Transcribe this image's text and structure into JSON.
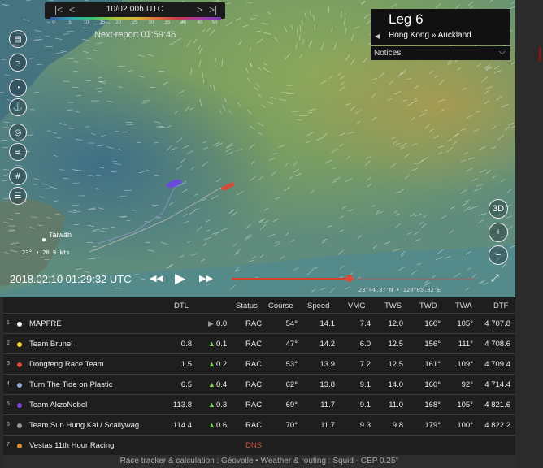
{
  "timebar": {
    "date": "10/02 00h UTC",
    "first": "|<",
    "prev": "<",
    "next": ">",
    "last": ">|"
  },
  "scale": {
    "ticks": [
      "0",
      "5",
      "10",
      "15",
      "20",
      "25",
      "30",
      "35",
      "40",
      "45",
      "50"
    ]
  },
  "next_report": "Next report 01:59:46",
  "leg": {
    "title": "Leg 6",
    "route": "Hong Kong » Auckland",
    "arrow": "◀"
  },
  "notices": {
    "label": "Notices",
    "chevron": "⌵"
  },
  "left_controls": [
    "layers-icon",
    "wind-icon",
    "compass-icon",
    "boat-icon",
    "target-icon",
    "gust-icon",
    "grid-icon",
    "ruler-icon"
  ],
  "right_controls": {
    "three_d": "3D",
    "zoom_in": "+",
    "zoom_out": "−"
  },
  "map": {
    "place_label": "Taiwan",
    "wind_readout": "23° • 20.9 kts",
    "coords": "23°44.87'N • 120°05.82'E"
  },
  "playback": {
    "timestamp": "2018.02.10 01:29:32 UTC",
    "rewind": "◀◀",
    "play": "▶",
    "forward": "▶▶",
    "progress": 0.48,
    "fullscreen": "⤢"
  },
  "table": {
    "headers": [
      "DTL",
      "Status",
      "Course",
      "Speed",
      "VMG",
      "TWS",
      "TWD",
      "TWA",
      "DTF"
    ],
    "rows": [
      {
        "rank": "1",
        "color": "#ffffff",
        "team": "MAPFRE",
        "dtl": "",
        "trend": "▶",
        "trend_val": "0.0",
        "trend_type": "flat",
        "status": "RAC",
        "course": "54°",
        "speed": "14.1",
        "vmg": "7.4",
        "tws": "12.0",
        "twd": "160°",
        "twa": "105°",
        "dtf": "4 707.8"
      },
      {
        "rank": "2",
        "color": "#f2d22e",
        "team": "Team Brunel",
        "dtl": "0.8",
        "trend": "▲",
        "trend_val": "0.1",
        "trend_type": "up",
        "status": "RAC",
        "course": "47°",
        "speed": "14.2",
        "vmg": "6.0",
        "tws": "12.5",
        "twd": "156°",
        "twa": "111°",
        "dtf": "4 708.6"
      },
      {
        "rank": "3",
        "color": "#e04a3a",
        "team": "Dongfeng Race Team",
        "dtl": "1.5",
        "trend": "▲",
        "trend_val": "0.2",
        "trend_type": "up",
        "status": "RAC",
        "course": "53°",
        "speed": "13.9",
        "vmg": "7.2",
        "tws": "12.5",
        "twd": "161°",
        "twa": "109°",
        "dtf": "4 709.4"
      },
      {
        "rank": "4",
        "color": "#8ea6d8",
        "team": "Turn The Tide on Plastic",
        "dtl": "6.5",
        "trend": "▲",
        "trend_val": "0.4",
        "trend_type": "up",
        "status": "RAC",
        "course": "62°",
        "speed": "13.8",
        "vmg": "9.1",
        "tws": "14.0",
        "twd": "160°",
        "twa": "92°",
        "dtf": "4 714.4"
      },
      {
        "rank": "5",
        "color": "#7a44d8",
        "team": "Team AkzoNobel",
        "dtl": "113.8",
        "trend": "▲",
        "trend_val": "0.3",
        "trend_type": "up",
        "status": "RAC",
        "course": "69°",
        "speed": "11.7",
        "vmg": "9.1",
        "tws": "11.0",
        "twd": "168°",
        "twa": "105°",
        "dtf": "4 821.6"
      },
      {
        "rank": "6",
        "color": "#9a9a9a",
        "team": "Team Sun Hung Kai / Scallywag",
        "dtl": "114.4",
        "trend": "▲",
        "trend_val": "0.6",
        "trend_type": "up",
        "status": "RAC",
        "course": "70°",
        "speed": "11.7",
        "vmg": "9.3",
        "tws": "9.8",
        "twd": "179°",
        "twa": "100°",
        "dtf": "4 822.2"
      },
      {
        "rank": "7",
        "color": "#e08a2e",
        "team": "Vestas 11th Hour Racing",
        "dtl": "",
        "trend": "",
        "trend_val": "",
        "trend_type": "none",
        "status": "DNS",
        "course": "",
        "speed": "",
        "vmg": "",
        "tws": "",
        "twd": "",
        "twa": "",
        "dtf": ""
      }
    ]
  },
  "footer": "Race tracker & calculation : Géovoile • Weather & routing : Squid - CEP 0.25°",
  "colors": {
    "accent": "#d1412c",
    "map_sea": "#4f7f86",
    "table_bg": "#1e1e1e"
  }
}
